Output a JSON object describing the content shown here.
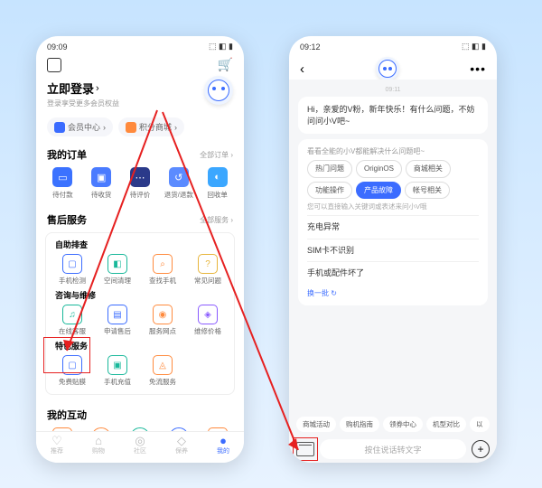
{
  "left": {
    "status": {
      "time": "09:09",
      "icons": "◉ ⬭ ◎ ✈",
      "right": "⬚ ◧ ▮"
    },
    "login_title": "立即登录",
    "login_sub": "登录享受更多会员权益",
    "pills": [
      {
        "label": "会员中心",
        "chev": "›"
      },
      {
        "label": "积分商城",
        "chev": "›"
      }
    ],
    "orders": {
      "title": "我的订单",
      "more": "全部订单 ›",
      "items": [
        {
          "label": "待付款"
        },
        {
          "label": "待收货"
        },
        {
          "label": "待评价"
        },
        {
          "label": "退货/退款"
        },
        {
          "label": "回收单"
        }
      ]
    },
    "service": {
      "title": "售后服务",
      "more": "全部服务 ›",
      "g1": {
        "title": "自助排查",
        "items": [
          {
            "label": "手机检测"
          },
          {
            "label": "空间清理"
          },
          {
            "label": "查找手机"
          },
          {
            "label": "常见问题"
          }
        ]
      },
      "g2": {
        "title": "咨询与维修",
        "items": [
          {
            "label": "在线客服"
          },
          {
            "label": "申请售后"
          },
          {
            "label": "服务网点"
          },
          {
            "label": "维修价格"
          }
        ]
      },
      "g3": {
        "title": "特色服务",
        "items": [
          {
            "label": "免费贴膜"
          },
          {
            "label": "手机充值"
          },
          {
            "label": "免流服务"
          }
        ]
      }
    },
    "interact": {
      "title": "我的互动"
    },
    "tabs": [
      {
        "label": "推荐"
      },
      {
        "label": "购物"
      },
      {
        "label": "社区"
      },
      {
        "label": "保养"
      },
      {
        "label": "我的"
      }
    ]
  },
  "right": {
    "status": {
      "time": "09:12",
      "icons": "◉ ⬭ ◎ ✈",
      "right": "⬚ ◧ ▮"
    },
    "time_stamp": "09:11",
    "greeting": "Hi，亲爱的V粉，新年快乐！有什么问题，不妨问问小V吧~",
    "cat_head": "看看全能的小V都能解决什么问题吧~",
    "cats": [
      {
        "label": "热门问题"
      },
      {
        "label": "OriginOS"
      },
      {
        "label": "商城相关"
      },
      {
        "label": "功能操作"
      },
      {
        "label": "产品故障",
        "active": true
      },
      {
        "label": "帐号相关"
      }
    ],
    "hint": "您可以直接输入关键词或表述来问小V哦",
    "faqs": [
      {
        "label": "充电异常"
      },
      {
        "label": "SIM卡不识别"
      },
      {
        "label": "手机或配件坏了"
      }
    ],
    "refresh": "换一批 ↻",
    "suggestions": [
      {
        "label": "商城活动"
      },
      {
        "label": "购机指南"
      },
      {
        "label": "领券中心"
      },
      {
        "label": "机型对比"
      },
      {
        "label": "以"
      }
    ],
    "input_placeholder": "按住说话转文字"
  }
}
